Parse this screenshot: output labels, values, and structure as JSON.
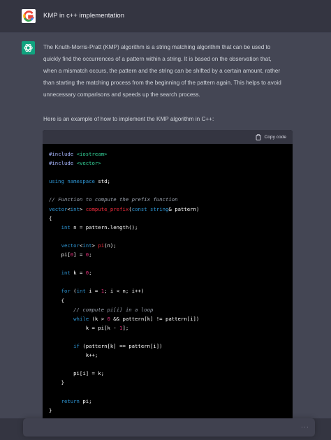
{
  "user": {
    "message": "KMP in c++ implementation"
  },
  "assistant": {
    "intro": "The Knuth-Morris-Pratt (KMP) algorithm is a string matching algorithm that can be used to quickly find the occurrences of a pattern within a string. It is based on the observation that, when a mismatch occurs, the pattern and the string can be shifted by a certain amount, rather than starting the matching process from the beginning of the pattern again. This helps to avoid unnecessary comparisons and speeds up the search process.",
    "example_line": "Here is an example of how to implement the KMP algorithm in C++:"
  },
  "code": {
    "copy_label": "Copy code",
    "lines": [
      "#include <iostream>",
      "#include <vector>",
      "",
      "using namespace std;",
      "",
      "// Function to compute the prefix function",
      "vector<int> compute_prefix(const string& pattern)",
      "{",
      "    int n = pattern.length();",
      "",
      "    vector<int> pi(n);",
      "    pi[0] = 0;",
      "",
      "    int k = 0;",
      "",
      "    for (int i = 1; i < n; i++)",
      "    {",
      "        // compute pi[i] in a loop",
      "        while (k > 0 && pattern[k] != pattern[i])",
      "            k = pi[k - 1];",
      "",
      "        if (pattern[k] == pattern[i])",
      "            k++;",
      "",
      "        pi[i] = k;",
      "    }",
      "",
      "    return pi;",
      "}"
    ]
  },
  "input": {
    "more_label": "···"
  }
}
